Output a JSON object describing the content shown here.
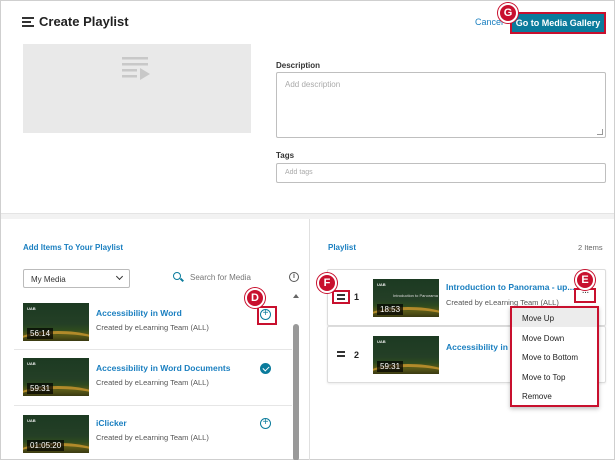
{
  "header": {
    "title": "Create Playlist",
    "cancel_label": "Cancel",
    "go_to_gallery_label": "Go to Media Gallery"
  },
  "callouts": {
    "d": "D",
    "e": "E",
    "f": "F",
    "g": "G"
  },
  "form": {
    "description_label": "Description",
    "description_placeholder": "Add description",
    "tags_label": "Tags",
    "tags_placeholder": "Add tags"
  },
  "add_items": {
    "title": "Add Items To Your Playlist",
    "source_select": "My Media",
    "search_placeholder": "Search for Media",
    "items": [
      {
        "title": "Accessibility in Word",
        "creator": "Created by eLearning Team (ALL)",
        "duration": "56:14",
        "state": "add"
      },
      {
        "title": "Accessibility in Word Documents",
        "creator": "Created by eLearning Team (ALL)",
        "duration": "59:31",
        "state": "added"
      },
      {
        "title": "iClicker",
        "creator": "Created by eLearning Team (ALL)",
        "duration": "01:05:20",
        "state": "add"
      }
    ]
  },
  "playlist": {
    "title": "Playlist",
    "count": "2 Items",
    "items": [
      {
        "number": "1",
        "title": "Introduction to Panorama - up...",
        "creator": "Created by eLearning Team (ALL)",
        "duration": "18:53",
        "thumb_caption": "Introduction to Panorama"
      },
      {
        "number": "2",
        "title": "Accessibility in W",
        "creator": "",
        "duration": "59:31"
      }
    ]
  },
  "item_menu": {
    "options": [
      "Move Up",
      "Move Down",
      "Move to Bottom",
      "Move to Top",
      "Remove"
    ],
    "active_index": 0
  },
  "colors": {
    "accent": "#0a7b9c",
    "link": "#1a7fc0",
    "callout": "#c8102e"
  }
}
